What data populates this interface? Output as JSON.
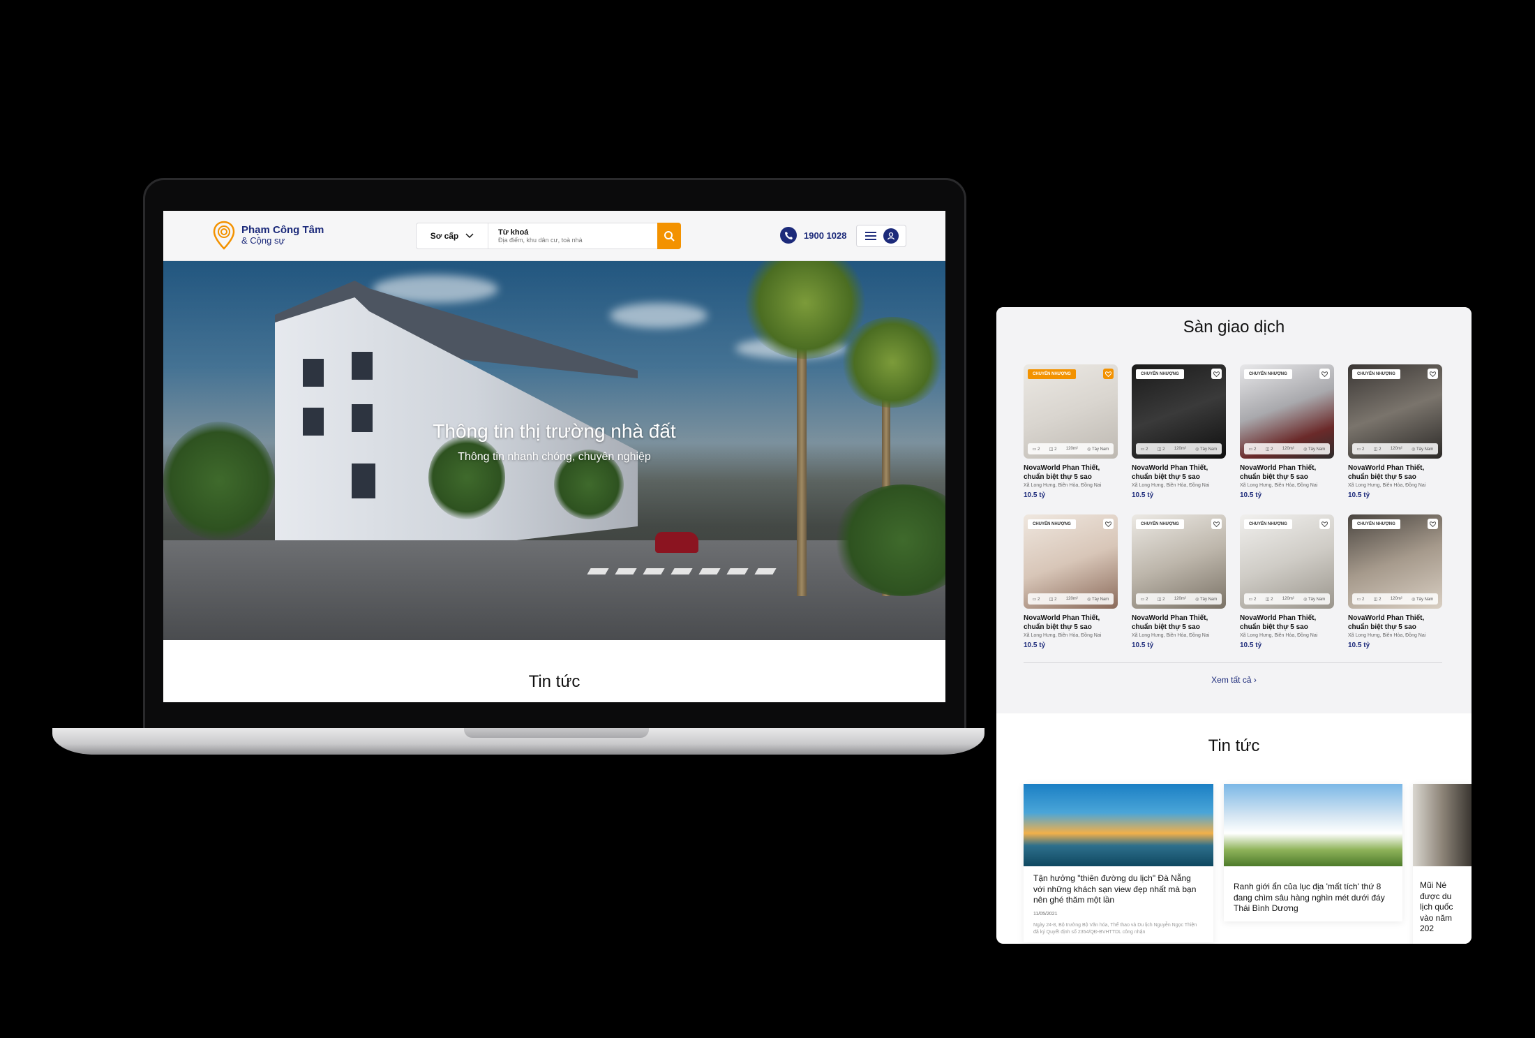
{
  "site": {
    "logo_name": "Phạm Công Tâm",
    "logo_sub": "& Cộng sự",
    "search": {
      "type_label": "Sơ cấp",
      "field_label": "Từ khoá",
      "placeholder": "Địa điểm, khu dân cư, toà nhà"
    },
    "phone": "1900 1028"
  },
  "hero": {
    "title": "Thông tin thị trường nhà đất",
    "subtitle": "Thông tin nhanh chóng, chuyên nghiệp"
  },
  "laptop_news_title": "Tin tức",
  "market": {
    "title": "Sàn giao dịch",
    "see_all": "Xem tất cả ›",
    "listings": [
      {
        "badge": "CHUYỂN NHƯỢNG",
        "name": "NovaWorld Phan Thiết, chuẩn biệt thự 5 sao",
        "address": "Xã Long Hưng, Biên Hòa, Đồng Nai",
        "price": "10.5 tỷ",
        "beds": "2",
        "baths": "2",
        "area": "120m²",
        "direction": "Tây Nam",
        "highlight": true
      },
      {
        "badge": "CHUYỂN NHƯỢNG",
        "name": "NovaWorld Phan Thiết, chuẩn biệt thự 5 sao",
        "address": "Xã Long Hưng, Biên Hòa, Đồng Nai",
        "price": "10.5 tỷ",
        "beds": "2",
        "baths": "2",
        "area": "120m²",
        "direction": "Tây Nam",
        "highlight": false
      },
      {
        "badge": "CHUYỂN NHƯỢNG",
        "name": "NovaWorld Phan Thiết, chuẩn biệt thự 5 sao",
        "address": "Xã Long Hưng, Biên Hòa, Đồng Nai",
        "price": "10.5 tỷ",
        "beds": "2",
        "baths": "2",
        "area": "120m²",
        "direction": "Tây Nam",
        "highlight": false
      },
      {
        "badge": "CHUYỂN NHƯỢNG",
        "name": "NovaWorld Phan Thiết, chuẩn biệt thự 5 sao",
        "address": "Xã Long Hưng, Biên Hòa, Đồng Nai",
        "price": "10.5 tỷ",
        "beds": "2",
        "baths": "2",
        "area": "120m²",
        "direction": "Tây Nam",
        "highlight": false
      },
      {
        "badge": "CHUYỂN NHƯỢNG",
        "name": "NovaWorld Phan Thiết, chuẩn biệt thự 5 sao",
        "address": "Xã Long Hưng, Biên Hòa, Đồng Nai",
        "price": "10.5 tỷ",
        "beds": "2",
        "baths": "2",
        "area": "120m²",
        "direction": "Tây Nam",
        "highlight": false
      },
      {
        "badge": "CHUYỂN NHƯỢNG",
        "name": "NovaWorld Phan Thiết, chuẩn biệt thự 5 sao",
        "address": "Xã Long Hưng, Biên Hòa, Đồng Nai",
        "price": "10.5 tỷ",
        "beds": "2",
        "baths": "2",
        "area": "120m²",
        "direction": "Tây Nam",
        "highlight": false
      },
      {
        "badge": "CHUYỂN NHƯỢNG",
        "name": "NovaWorld Phan Thiết, chuẩn biệt thự 5 sao",
        "address": "Xã Long Hưng, Biên Hòa, Đồng Nai",
        "price": "10.5 tỷ",
        "beds": "2",
        "baths": "2",
        "area": "120m²",
        "direction": "Tây Nam",
        "highlight": false
      },
      {
        "badge": "CHUYỂN NHƯỢNG",
        "name": "NovaWorld Phan Thiết, chuẩn biệt thự 5 sao",
        "address": "Xã Long Hưng, Biên Hòa, Đồng Nai",
        "price": "10.5 tỷ",
        "beds": "2",
        "baths": "2",
        "area": "120m²",
        "direction": "Tây Nam",
        "highlight": false
      }
    ]
  },
  "news": {
    "title": "Tin tức",
    "articles": [
      {
        "headline": "Tận hưởng \"thiên đường du lịch\" Đà Nẵng với những khách sạn view đẹp nhất mà bạn nên ghé thăm một lần",
        "date": "11/05/2021",
        "excerpt": "Ngày 24-8, Bộ trưởng Bộ Văn hóa, Thể thao và Du lịch Nguyễn Ngọc Thiện đã ký Quyết định số 2354/QĐ-BVHTTDL công nhận"
      },
      {
        "headline": "Ranh giới ẩn của lục địa 'mất tích' thứ 8 đang chìm sâu hàng nghìn mét dưới đáy Thái Bình Dương",
        "date": "",
        "excerpt": ""
      },
      {
        "headline": "Mũi Né được du lịch quốc vào năm 202",
        "date": "",
        "excerpt": ""
      }
    ]
  },
  "colors": {
    "brand_navy": "#1c2a7a",
    "accent_orange": "#f39200"
  }
}
